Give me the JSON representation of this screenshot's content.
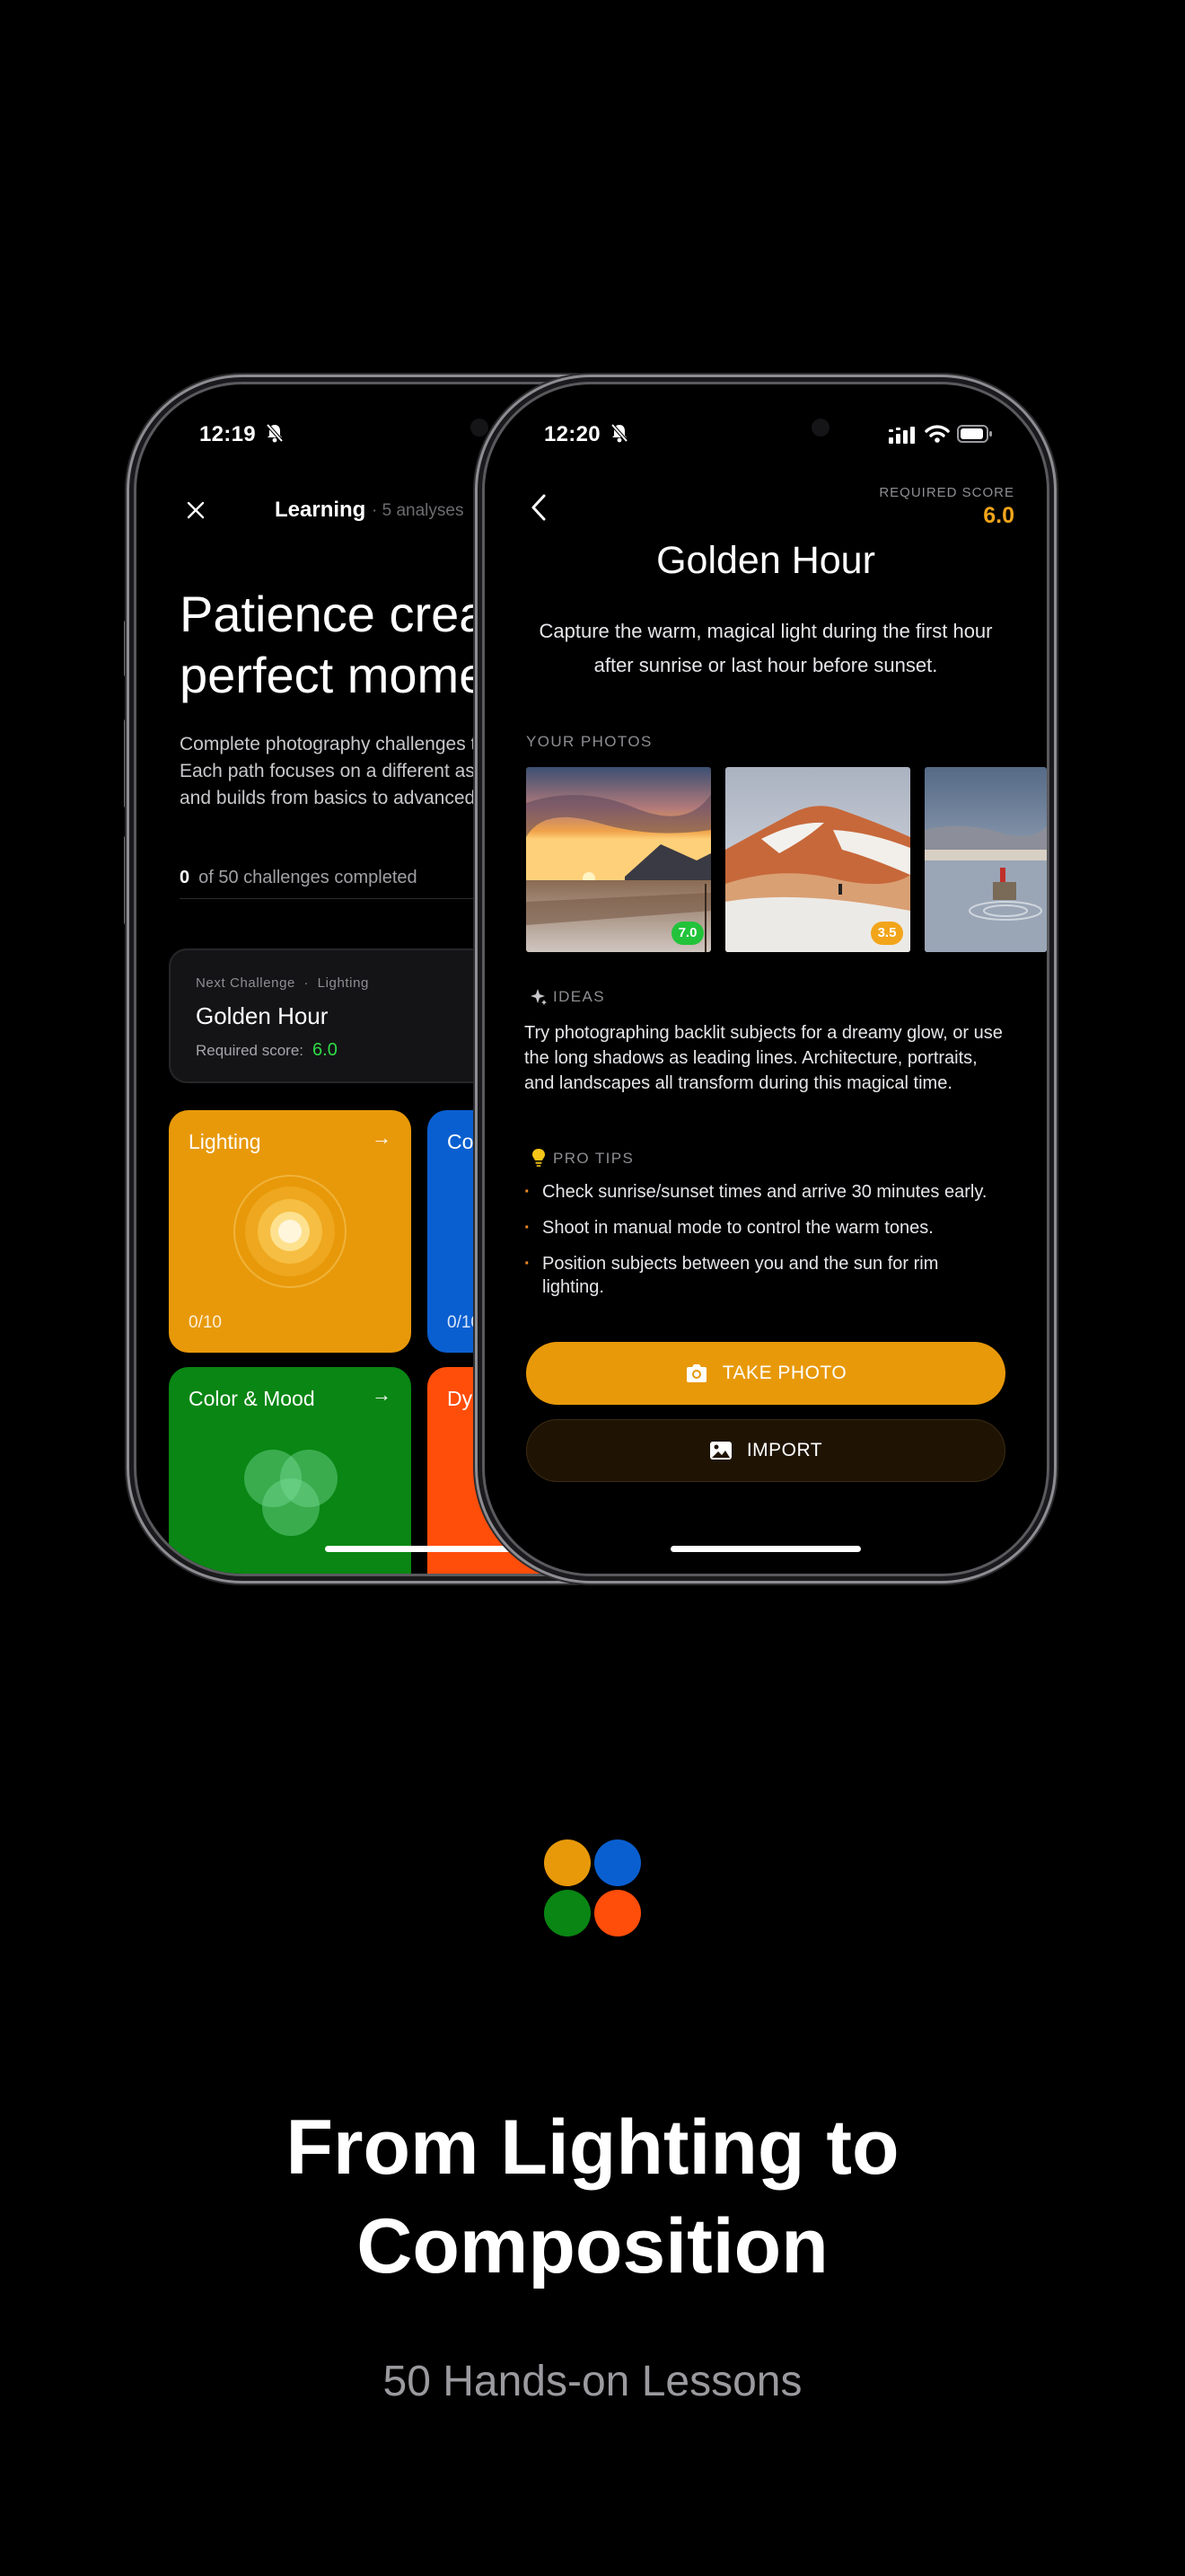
{
  "back_phone": {
    "time": "12:19",
    "header_title": "Learning",
    "header_meta": "· 5 analyses",
    "headline_line1": "Patience creat",
    "headline_line2": "perfect mome",
    "description_line1": "Complete photography challenges t",
    "description_line2": "Each path focuses on a different as",
    "description_line3": "and builds from basics to advanced",
    "progress_count": "0",
    "progress_text": "of 50 challenges completed",
    "next_challenge": {
      "label": "Next Challenge",
      "category": "Lighting",
      "title": "Golden Hour",
      "score_label": "Required score:",
      "score_value": "6.0"
    },
    "tiles": [
      {
        "name": "Lighting",
        "count": "0/10",
        "color": "#e8990a"
      },
      {
        "name": "Cor",
        "count": "0/10",
        "color": "#0a5fd0"
      },
      {
        "name": "Color & Mood",
        "count": "",
        "color": "#098613"
      },
      {
        "name": "Dyn",
        "count": "",
        "color": "#ff4d0a"
      }
    ]
  },
  "front_phone": {
    "time": "12:20",
    "required_score_label": "REQUIRED SCORE",
    "required_score_value": "6.0",
    "title": "Golden Hour",
    "subtitle": "Capture the warm, magical light during the first hour after sunrise or last hour before sunset.",
    "your_photos_label": "YOUR PHOTOS",
    "photos": [
      {
        "score": "7.0",
        "badge_color": "#22c33a"
      },
      {
        "score": "3.5",
        "badge_color": "#f2a51a"
      },
      {
        "score": "",
        "badge_color": ""
      }
    ],
    "ideas_label": "IDEAS",
    "ideas_text": "Try photographing backlit subjects for a dreamy glow, or use the long shadows as leading lines. Architecture, portraits, and landscapes all transform during this magical time.",
    "pro_tips_label": "PRO TIPS",
    "tips": [
      "Check sunrise/sunset times and arrive 30 minutes early.",
      "Shoot in manual mode to control the warm tones.",
      "Position subjects between you and the sun for rim lighting."
    ],
    "take_photo_label": "TAKE PHOTO",
    "import_label": "IMPORT"
  },
  "logo_colors": [
    "#e8990a",
    "#0a5fd0",
    "#098613",
    "#ff4d0a"
  ],
  "hero_title_line1": "From Lighting to",
  "hero_title_line2": "Composition",
  "hero_subtitle": "50 Hands-on Lessons",
  "colors": {
    "accent_orange": "#e8990a",
    "score_green": "#2ddc47",
    "required_score": "#f2a51a"
  }
}
